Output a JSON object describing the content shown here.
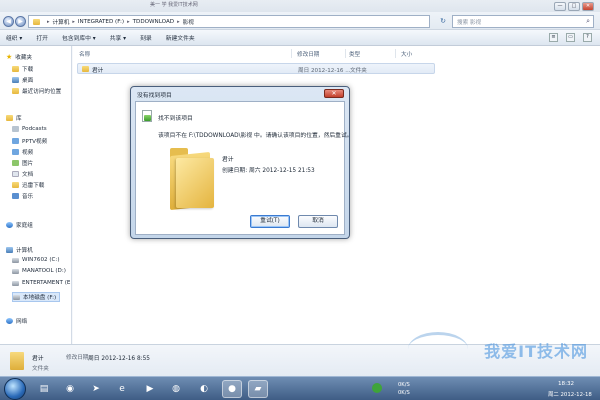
{
  "window": {
    "title": "美一 学 我爱IT技术网",
    "buttons": [
      "—",
      "□",
      "✕"
    ]
  },
  "address": {
    "crumbs": [
      "计算机",
      "INTEGRATED (F:)",
      "TDDOWNLOAD",
      "影视"
    ],
    "search_placeholder": "搜索 影视"
  },
  "toolbar": {
    "organize": "组织 ▾",
    "open": "打开",
    "include_library": "包含到库中 ▾",
    "share": "共享 ▾",
    "burn": "刻录",
    "new_folder": "新建文件夹"
  },
  "sidebar": {
    "favorites": "收藏夹",
    "downloads": "下载",
    "desktop": "桌面",
    "recent": "最近访问的位置",
    "libraries": "库",
    "podcasts": "Podcasts",
    "pptv": "PPTV视频",
    "videos": "视频",
    "pictures": "图片",
    "documents": "文档",
    "xunlei": "迅雷下载",
    "music": "音乐",
    "homegroup": "家庭组",
    "computer": "计算机",
    "drive_c": "WIN7602 (C:)",
    "drive_d": "MANATOOL (D:)",
    "drive_e": "ENTERTAMENT (E",
    "drive_f": "本地磁盘 (F:)",
    "network": "网络"
  },
  "columns": {
    "name": "名称",
    "modified": "修改日期",
    "type": "类型",
    "size": "大小"
  },
  "row": {
    "name": "君计",
    "modified": "周日 2012-12-16 ...",
    "type": "文件夹"
  },
  "dialog": {
    "title": "没有找到项目",
    "close": "✕",
    "heading": "找不到该项目",
    "message": "该项目不在 F:\\TDDOWNLOAD\\影视 中。请确认该项目的位置，然后重试。",
    "file_name": "君计",
    "created": "创建日期: 周六 2012-12-15 21:53",
    "retry": "重试(T)",
    "cancel": "取消"
  },
  "details": {
    "name": "君计",
    "modified_label": "修改日期:",
    "modified_value": "周日 2012-12-16 8:55",
    "type": "文件夹"
  },
  "watermark": "我爱IT技术网",
  "tray": {
    "speed_up": "0K/S",
    "speed_down": "0K/S",
    "time": "18:32",
    "date": "周二 2012-12-18"
  },
  "colors": {
    "accent": "#3b7ad0",
    "folder": "#e4b43f",
    "close_red": "#c3402c",
    "taskbar": "#3f5d85"
  },
  "icons": {
    "taskbar_apps": [
      "explorer-icon",
      "media-player-icon",
      "arrow-app-icon",
      "ie-icon",
      "firefox-icon",
      "qq-icon",
      "player-icon",
      "app-icon"
    ]
  }
}
